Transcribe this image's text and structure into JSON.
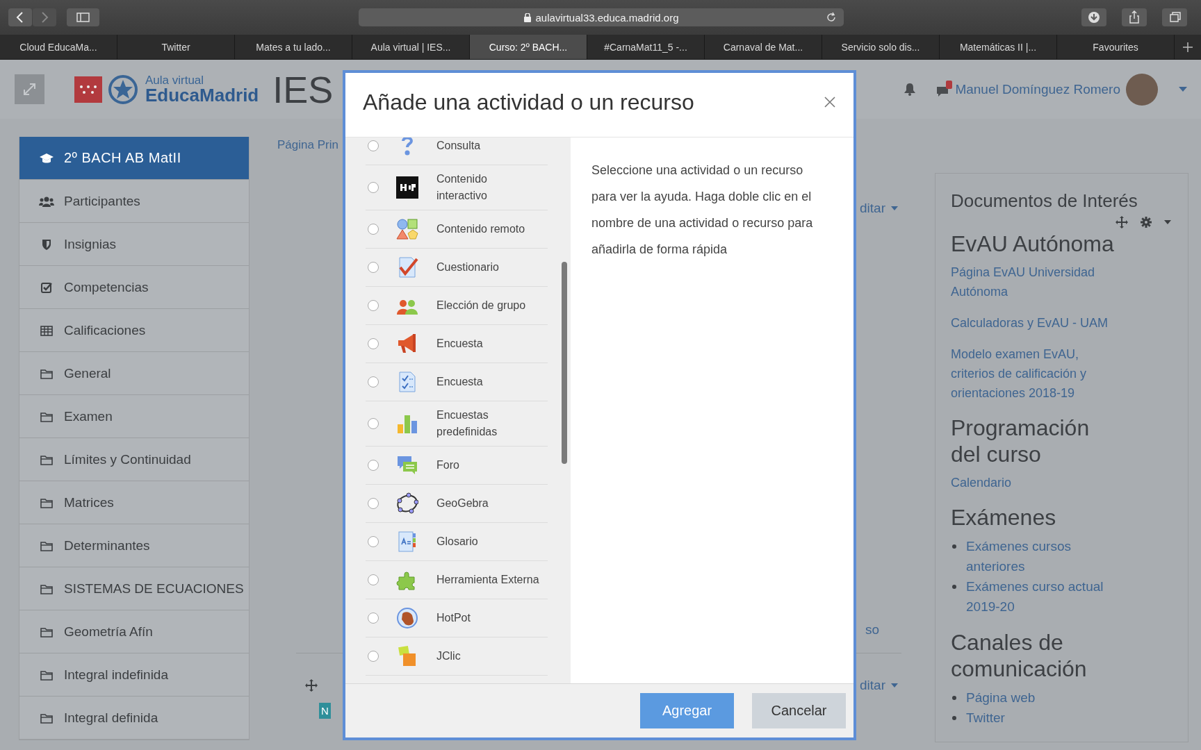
{
  "browser": {
    "url": "aulavirtual33.educa.madrid.org",
    "tabs": [
      {
        "label": "Cloud EducaMa...",
        "selected": false
      },
      {
        "label": "Twitter",
        "selected": false
      },
      {
        "label": "Mates a tu lado...",
        "selected": false
      },
      {
        "label": "Aula virtual | IES...",
        "selected": false
      },
      {
        "label": "Curso: 2º BACH...",
        "selected": true
      },
      {
        "label": "#CarnaMat11_5 -...",
        "selected": false
      },
      {
        "label": "Carnaval de Mat...",
        "selected": false
      },
      {
        "label": "Servicio solo dis...",
        "selected": false
      },
      {
        "label": "Matemáticas II |...",
        "selected": false
      },
      {
        "label": "Favourites",
        "selected": false
      }
    ]
  },
  "header": {
    "logo_top": "Aula virtual",
    "logo_bottom": "EducaMadrid",
    "site_title": "IES",
    "user_name": "Manuel Domínguez Romero"
  },
  "sidebar": {
    "items": [
      {
        "label": "2º BACH AB MatII",
        "kind": "course",
        "selected": true
      },
      {
        "label": "Participantes",
        "kind": "users",
        "selected": false
      },
      {
        "label": "Insignias",
        "kind": "shield",
        "selected": false
      },
      {
        "label": "Competencias",
        "kind": "check",
        "selected": false
      },
      {
        "label": "Calificaciones",
        "kind": "table",
        "selected": false
      },
      {
        "label": "General",
        "kind": "folder",
        "selected": false
      },
      {
        "label": "Examen",
        "kind": "folder",
        "selected": false
      },
      {
        "label": "Límites y Continuidad",
        "kind": "folder",
        "selected": false
      },
      {
        "label": "Matrices",
        "kind": "folder",
        "selected": false
      },
      {
        "label": "Determinantes",
        "kind": "folder",
        "selected": false
      },
      {
        "label": "SISTEMAS DE ECUACIONES",
        "kind": "folder",
        "selected": false
      },
      {
        "label": "Geometría Afín",
        "kind": "folder",
        "selected": false
      },
      {
        "label": "Integral indefinida",
        "kind": "folder",
        "selected": false
      },
      {
        "label": "Integral definida",
        "kind": "folder",
        "selected": false
      }
    ]
  },
  "main": {
    "breadcrumb": "Página Prin",
    "top_edit": "ditar",
    "fragment": "so",
    "bottom_edit": "ditar",
    "badge": "N"
  },
  "block": {
    "title": "Documentos de Interés",
    "sections": [
      {
        "heading": "EvAU Autónoma",
        "kind": "links",
        "links": [
          "Página EvAU Universidad Autónoma",
          "Calculadoras y EvAU - UAM",
          "Modelo examen EvAU, criterios de calificación y orientaciones 2018-19"
        ]
      },
      {
        "heading": "Programación del curso",
        "kind": "links",
        "links": [
          "Calendario"
        ]
      },
      {
        "heading": "Exámenes",
        "kind": "bullets",
        "links": [
          "Exámenes cursos anteriores",
          "Exámenes curso actual 2019-20"
        ]
      },
      {
        "heading": "Canales de comunicación",
        "kind": "bullets",
        "links": [
          "Página web",
          "Twitter"
        ]
      }
    ]
  },
  "modal": {
    "title": "Añade una actividad o un recurso",
    "items": [
      {
        "label": "Consulta",
        "kind": "question",
        "selected": false
      },
      {
        "label": "Contenido interactivo",
        "kind": "h5p",
        "selected": false
      },
      {
        "label": "Contenido remoto",
        "kind": "shapes",
        "selected": false
      },
      {
        "label": "Cuestionario",
        "kind": "quiz",
        "selected": false
      },
      {
        "label": "Elección de grupo",
        "kind": "group",
        "selected": false
      },
      {
        "label": "Encuesta",
        "kind": "megaphone",
        "selected": false
      },
      {
        "label": "Encuesta",
        "kind": "survey",
        "selected": false
      },
      {
        "label": "Encuestas predefinidas",
        "kind": "chart",
        "selected": false
      },
      {
        "label": "Foro",
        "kind": "forum",
        "selected": false
      },
      {
        "label": "GeoGebra",
        "kind": "geogebra",
        "selected": false
      },
      {
        "label": "Glosario",
        "kind": "glossary",
        "selected": false
      },
      {
        "label": "Herramienta Externa",
        "kind": "puzzle",
        "selected": false
      },
      {
        "label": "HotPot",
        "kind": "hotpot",
        "selected": false
      },
      {
        "label": "JClic",
        "kind": "jclic",
        "selected": false
      }
    ],
    "help": "Seleccione una actividad o un recurso para ver la ayuda. Haga doble clic en el nombre de una actividad o recurso para añadirla de forma rápida",
    "buttons": [
      {
        "label": "Agregar",
        "kind": "primary"
      },
      {
        "label": "Cancelar",
        "kind": "secondary"
      }
    ]
  }
}
